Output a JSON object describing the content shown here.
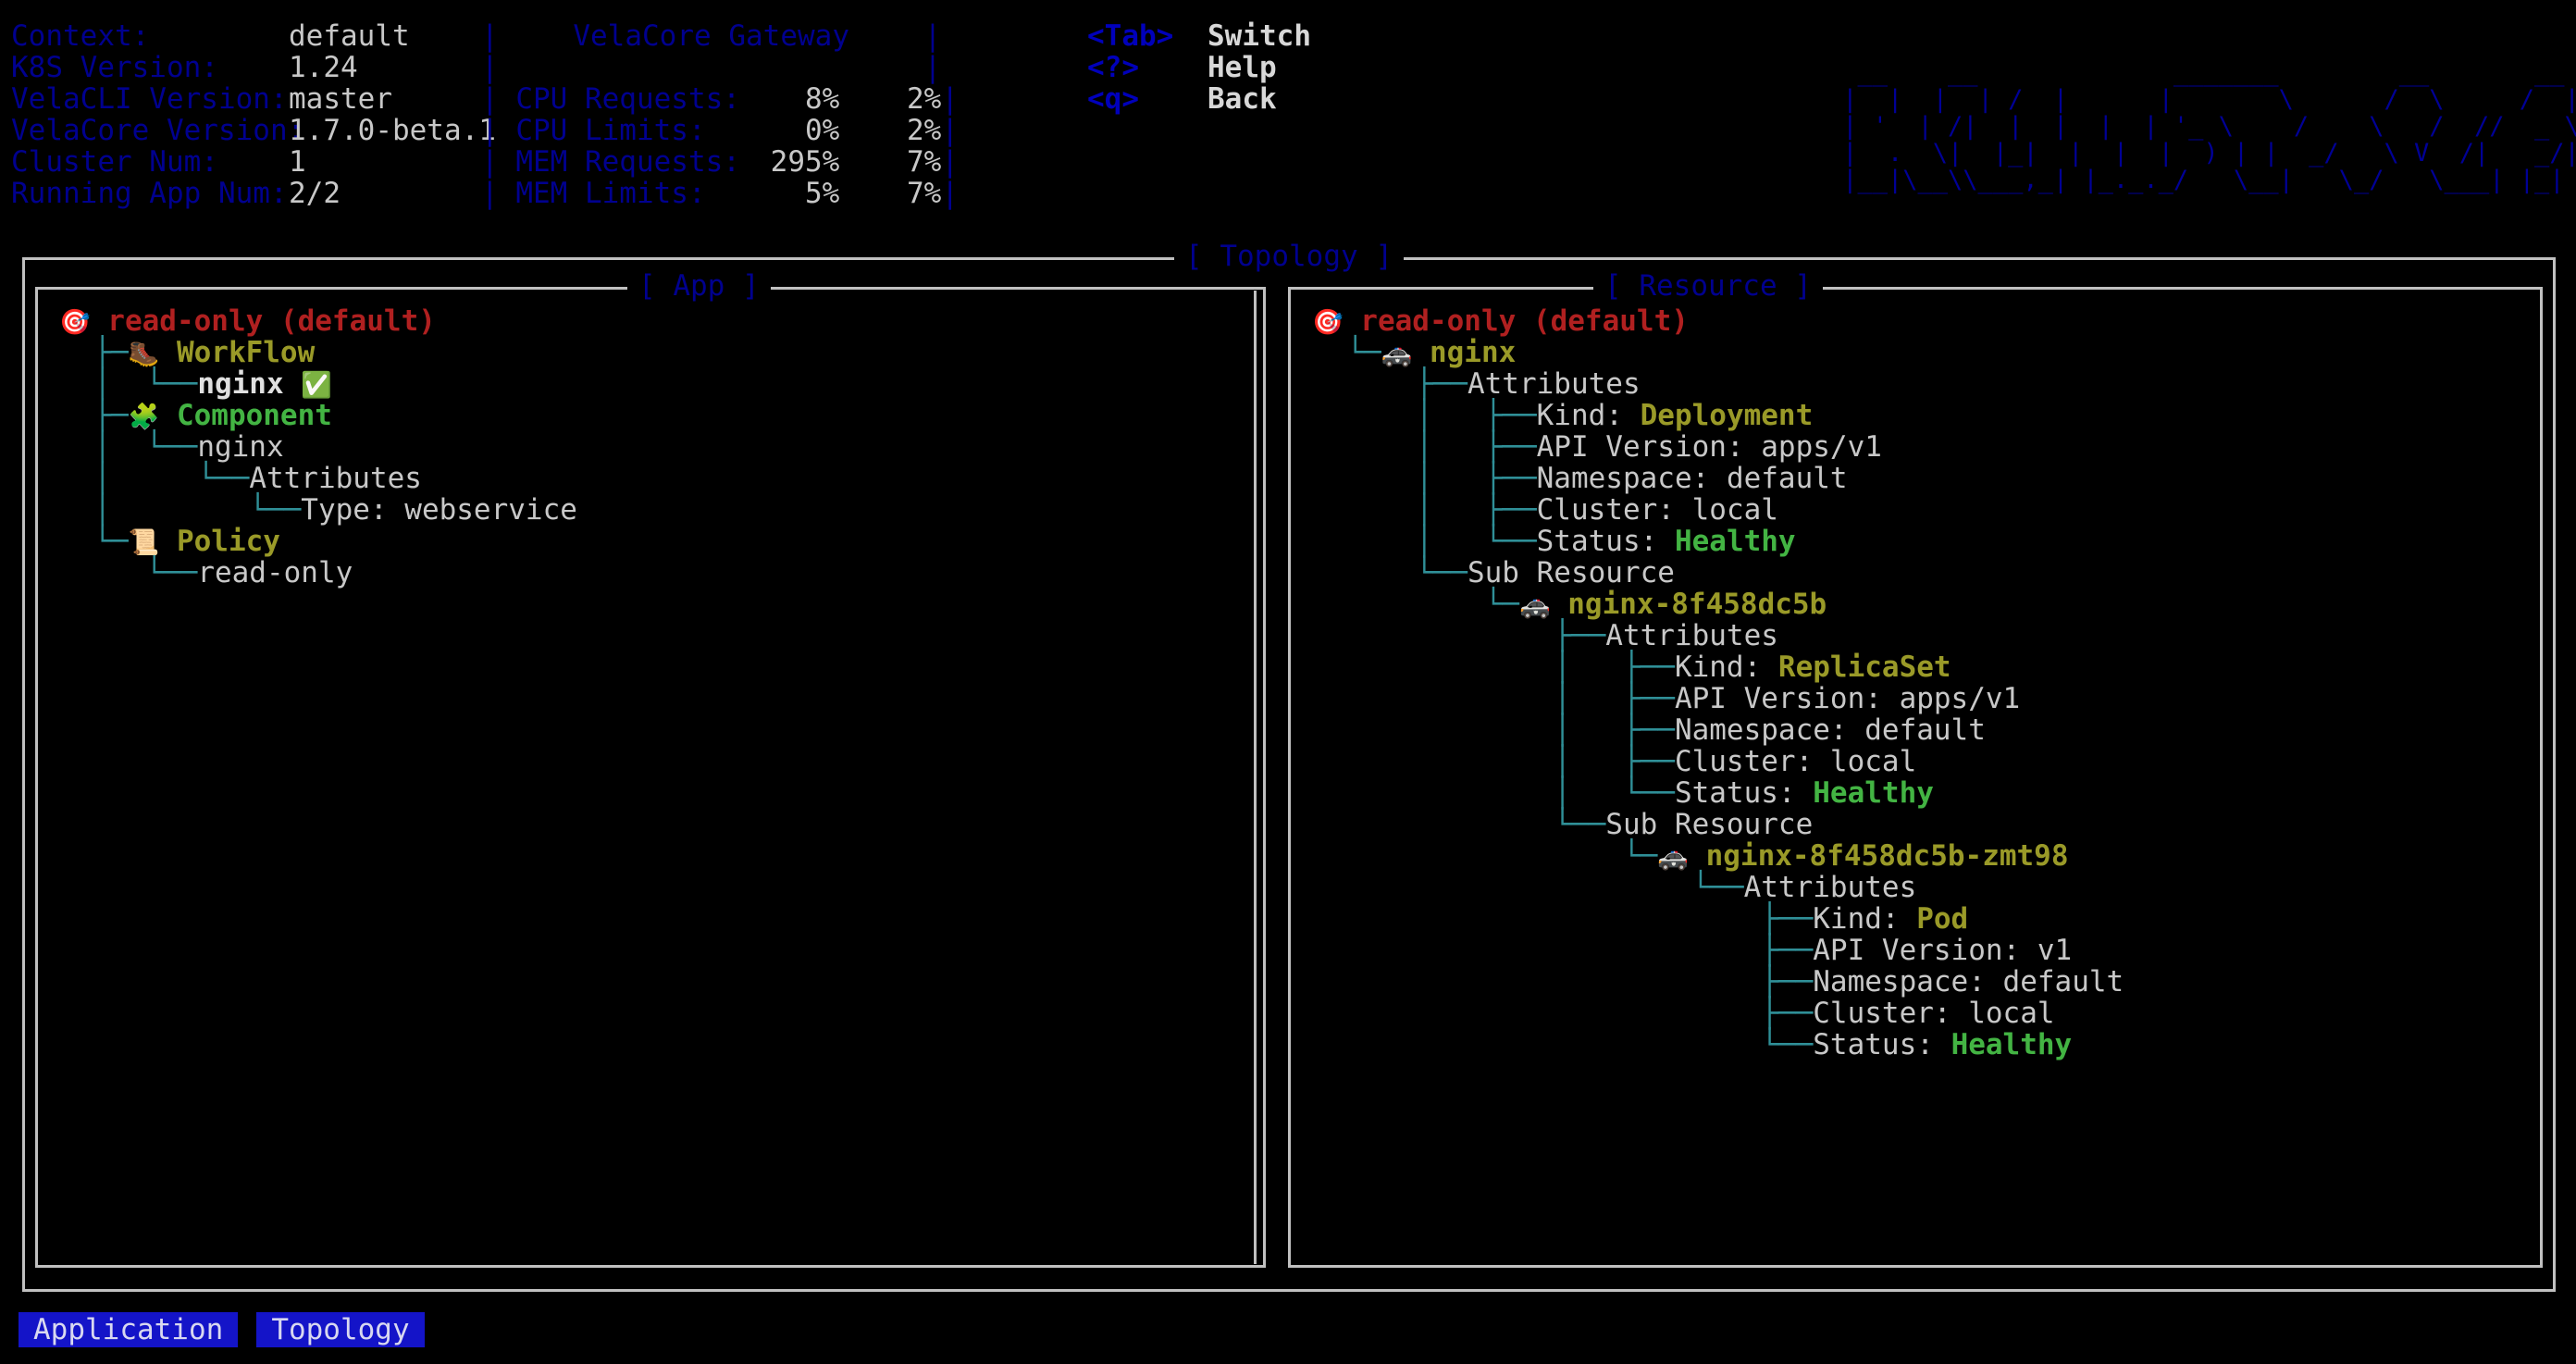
{
  "header": {
    "info_rows": [
      {
        "label": "Context:",
        "value": "default"
      },
      {
        "label": "K8S Version:",
        "value": "1.24"
      },
      {
        "label": "VelaCLI Version:",
        "value": "master"
      },
      {
        "label": "VelaCore Version:",
        "value": "1.7.0-beta.1"
      },
      {
        "label": "Cluster Num:",
        "value": "1"
      },
      {
        "label": "Running App Num:",
        "value": "2/2"
      }
    ],
    "gateway_title": "VelaCore Gateway",
    "metric_rows": [
      {
        "label": "CPU Requests:",
        "col1": "8%",
        "col2": "2%"
      },
      {
        "label": "CPU Limits:",
        "col1": "0%",
        "col2": "2%"
      },
      {
        "label": "MEM Requests:",
        "col1": "295%",
        "col2": "7%"
      },
      {
        "label": "MEM Limits:",
        "col1": "5%",
        "col2": "7%"
      }
    ],
    "keys": [
      {
        "key": "<Tab>",
        "desc": "Switch"
      },
      {
        "key": "<?>",
        "desc": "Help"
      },
      {
        "key": "<q>",
        "desc": "Back"
      }
    ],
    "logo_ascii": "  __    __             _______        __       __   ______   __        ______   \n |  |  |  | /  |      |       \\      /  \\     /  | /      \\ |  |      /      \\  \n | '  | /|  |  |  |  | '_ \\    /    \\   /  //  _ \\| | /  _\\ |\n |  .  \\| |_| |  |  |) | | |  _/  \\ V /|   _/| || ( | | \n |__|\\__\\\\___,_||_._._/  \\__|  \\_/  \\___||_| \\___,_|",
    "logo_lines": [
      "  __    __             _______        __       __   ______   __        ______",
      " |  |  |  | /  |      |       \\      /  \\     /  | /      \\ |  |      /      \\",
      " | '  | /|  |  |  |  | '_ \\    /    \\   /  //  _ \\| |  | /  _\\|",
      " |  .  \\|  |_|  |  |  |  ) | |  _/   \\ V  /|   _/|  |  | | (_| |",
      " |__|\\__\\\\___,_| |_._._/   \\__|   \\_/   \\___| |_| \\___,_|"
    ]
  },
  "topology": {
    "panel_title": "[ Topology ]",
    "app": {
      "panel_title": "[ App ]",
      "rows": [
        {
          "guide": "",
          "icon": "dart-target",
          "glyph": "🎯",
          "text": "read-only (default)",
          "style": "t-red"
        },
        {
          "guide": "  ├─",
          "icon": "boot",
          "glyph": "🥾",
          "text": "WorkFlow",
          "style": "t-olive"
        },
        {
          "guide": "  │  └──",
          "icon": "",
          "glyph": "",
          "text": "nginx ",
          "style": "t-white",
          "suffix_icon": "check-mark",
          "suffix_glyph": "✅"
        },
        {
          "guide": "  ├─",
          "icon": "puzzle-piece",
          "glyph": "🧩",
          "text": "Component",
          "style": "t-green"
        },
        {
          "guide": "  │  └──",
          "icon": "",
          "glyph": "",
          "text": "nginx",
          "style": "t-grey"
        },
        {
          "guide": "  │     └──",
          "icon": "",
          "glyph": "",
          "text": "Attributes",
          "style": "t-grey"
        },
        {
          "guide": "  │        └──",
          "icon": "",
          "glyph": "",
          "text": "Type: webservice",
          "style": "t-grey"
        },
        {
          "guide": "  └─",
          "icon": "scroll",
          "glyph": "📜",
          "text": "Policy",
          "style": "t-olive"
        },
        {
          "guide": "     └──",
          "icon": "",
          "glyph": "",
          "text": "read-only",
          "style": "t-grey"
        }
      ]
    },
    "resource": {
      "panel_title": "[ Resource ]",
      "rows": [
        {
          "guide": "",
          "icon": "dart-target",
          "glyph": "🎯",
          "text": "read-only (default)",
          "style": "t-red"
        },
        {
          "guide": "  └─",
          "icon": "police-car",
          "glyph": "🚓",
          "text": "nginx",
          "style": "t-olive"
        },
        {
          "guide": "      ├──",
          "icon": "",
          "glyph": "",
          "text": "Attributes",
          "style": "t-grey"
        },
        {
          "guide": "      │   ├──",
          "icon": "",
          "glyph": "",
          "text": "Kind: ",
          "style": "t-grey",
          "value": "Deployment",
          "value_style": "t-olive"
        },
        {
          "guide": "      │   ├──",
          "icon": "",
          "glyph": "",
          "text": "API Version: apps/v1",
          "style": "t-grey"
        },
        {
          "guide": "      │   ├──",
          "icon": "",
          "glyph": "",
          "text": "Namespace: default",
          "style": "t-grey"
        },
        {
          "guide": "      │   ├──",
          "icon": "",
          "glyph": "",
          "text": "Cluster: local",
          "style": "t-grey"
        },
        {
          "guide": "      │   └──",
          "icon": "",
          "glyph": "",
          "text": "Status: ",
          "style": "t-grey",
          "value": "Healthy",
          "value_style": "t-green"
        },
        {
          "guide": "      └──",
          "icon": "",
          "glyph": "",
          "text": "Sub Resource",
          "style": "t-grey"
        },
        {
          "guide": "          └─",
          "icon": "police-car",
          "glyph": "🚓",
          "text": "nginx-8f458dc5b",
          "style": "t-olive"
        },
        {
          "guide": "              ├──",
          "icon": "",
          "glyph": "",
          "text": "Attributes",
          "style": "t-grey"
        },
        {
          "guide": "              │   ├──",
          "icon": "",
          "glyph": "",
          "text": "Kind: ",
          "style": "t-grey",
          "value": "ReplicaSet",
          "value_style": "t-olive"
        },
        {
          "guide": "              │   ├──",
          "icon": "",
          "glyph": "",
          "text": "API Version: apps/v1",
          "style": "t-grey"
        },
        {
          "guide": "              │   ├──",
          "icon": "",
          "glyph": "",
          "text": "Namespace: default",
          "style": "t-grey"
        },
        {
          "guide": "              │   ├──",
          "icon": "",
          "glyph": "",
          "text": "Cluster: local",
          "style": "t-grey"
        },
        {
          "guide": "              │   └──",
          "icon": "",
          "glyph": "",
          "text": "Status: ",
          "style": "t-grey",
          "value": "Healthy",
          "value_style": "t-green"
        },
        {
          "guide": "              └──",
          "icon": "",
          "glyph": "",
          "text": "Sub Resource",
          "style": "t-grey"
        },
        {
          "guide": "                  └─",
          "icon": "police-car",
          "glyph": "🚓",
          "text": "nginx-8f458dc5b-zmt98",
          "style": "t-olive"
        },
        {
          "guide": "                      └──",
          "icon": "",
          "glyph": "",
          "text": "Attributes",
          "style": "t-grey"
        },
        {
          "guide": "                          ├──",
          "icon": "",
          "glyph": "",
          "text": "Kind: ",
          "style": "t-grey",
          "value": "Pod",
          "value_style": "t-olive"
        },
        {
          "guide": "                          ├──",
          "icon": "",
          "glyph": "",
          "text": "API Version: v1",
          "style": "t-grey"
        },
        {
          "guide": "                          ├──",
          "icon": "",
          "glyph": "",
          "text": "Namespace: default",
          "style": "t-grey"
        },
        {
          "guide": "                          ├──",
          "icon": "",
          "glyph": "",
          "text": "Cluster: local",
          "style": "t-grey"
        },
        {
          "guide": "                          └──",
          "icon": "",
          "glyph": "",
          "text": "Status: ",
          "style": "t-grey",
          "value": "Healthy",
          "value_style": "t-green"
        }
      ]
    }
  },
  "footer": {
    "tabs": [
      {
        "label": "Application"
      },
      {
        "label": "Topology"
      }
    ]
  },
  "colors": {
    "background": "#000000",
    "label_blue": "#00008f",
    "key_blue": "#0000bb",
    "text_grey": "#c8c8c8",
    "border_grey": "#c0c0c0",
    "tree_guide": "#2f8f97",
    "red": "#b02020",
    "olive": "#9a9a28",
    "green": "#43b443",
    "tab_bg": "#1414c8"
  }
}
